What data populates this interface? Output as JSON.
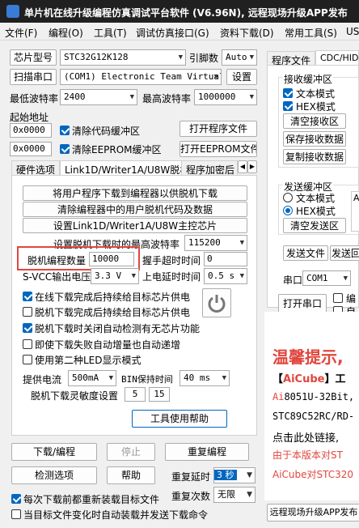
{
  "window": {
    "title": "单片机在线升级编程仿真调试平台软件 (V6.96N), 远程现场升级APP发布"
  },
  "menu": [
    "文件(F)",
    "编程(O)",
    "工具(T)",
    "调试仿真接口(G)",
    "资料下载(D)",
    "常用工具(S)",
    "US"
  ],
  "chip": {
    "label": "芯片型号",
    "value": "STC32G12K128",
    "pin_label": "引脚数",
    "pin_value": "Auto"
  },
  "port": {
    "scan_label": "扫描串口",
    "value": "(COM1) Electronic Team Virtual",
    "settings_label": "设置"
  },
  "baud": {
    "min_label": "最低波特率",
    "min_value": "2400",
    "max_label": "最高波特率",
    "max_value": "1000000"
  },
  "start_addr": {
    "label": "起始地址",
    "code_value": "0x0000",
    "clear_code_label": "清除代码缓冲区",
    "eeprom_value": "0x0000",
    "clear_eeprom_label": "清除EEPROM缓冲区",
    "open_prog_label": "打开程序文件",
    "open_eeprom_label": "打开EEPROM文件"
  },
  "tabs": [
    "硬件选项",
    "Link1D/Writer1A/U8W脱机",
    "程序加密后"
  ],
  "offline": {
    "btn_download": "将用户程序下载到编程器以供脱机下载",
    "btn_clear": "清除编程器中的用户脱机代码及数据",
    "btn_setup": "设置Link1D/Writer1A/U8W主控芯片",
    "max_baud_label": "设置脱机下载时的最高波特率",
    "max_baud_value": "115200",
    "count_label": "脱机编程数量",
    "count_value": "10000",
    "handshake_label": "握手超时时间",
    "handshake_value": "0",
    "svcc_label": "S-VCC输出电压",
    "svcc_value": "3.3 V",
    "powerup_label": "上电延时时间",
    "powerup_value": "0.5 s",
    "opt1": "在线下载完成后持续给目标芯片供电",
    "opt2": "脱机下载完成后持续给目标芯片供电",
    "opt3": "脱机下载时关闭自动检测有无芯片功能",
    "opt4": "即使下载失败自动增量也自动递增",
    "opt5": "使用第二种LED显示模式",
    "current_label": "提供电流",
    "current_value": "500mA",
    "bin_label": "BIN保持时间",
    "bin_value": "40 ms",
    "sens_label": "脱机下载灵敏度设置",
    "sens_a": "5",
    "sens_b": "15",
    "help_label": "工具使用帮助"
  },
  "bottom": {
    "download_label": "下载/编程",
    "stop_label": "停止",
    "reprog_label": "重复编程",
    "detect_label": "检测选项",
    "help_label": "帮助",
    "delay_label": "重复延时",
    "delay_value": "3 秒",
    "count_label": "重复次数",
    "count_value": "无限",
    "reload_label": "每次下载前都重新装载目标文件",
    "autoload_label": "当目标文件变化时自动装载并发送下载命令"
  },
  "right": {
    "tab_prog": "程序文件",
    "tab_cdc": "CDC/HID",
    "recv_title": "接收缓冲区",
    "text_mode": "文本模式",
    "hex_mode": "HEX模式",
    "clear_recv": "清空接收区",
    "save_recv": "保存接收数据",
    "copy_recv": "复制接收数据",
    "send_title": "发送缓冲区",
    "send_text_mode": "文本模式",
    "send_hex_mode": "HEX模式",
    "clear_send": "清空发送区",
    "send_file": "发送文件",
    "send_back": "发送回",
    "serial_label": "串口",
    "serial_value": "COM1",
    "open_serial": "打开串口",
    "edit_label": "编",
    "auto_label": "自",
    "send_box_text": "A.",
    "remote_publish": "远程现场升级APP发布"
  },
  "ad": {
    "title": "温馨提示,",
    "line1_pre": "【",
    "line1_brand": "AiCube",
    "line1_post": "】工",
    "line2_ai": "Ai",
    "line2_rest": "8051U-32Bit,",
    "line3": "STC89C52RC/RD-",
    "line4": "点击此处链接,",
    "line5": "由于本版本对ST",
    "line6": "AiCube对STC320",
    "red": "#e0463e",
    "blue": "#1c3a9e"
  }
}
